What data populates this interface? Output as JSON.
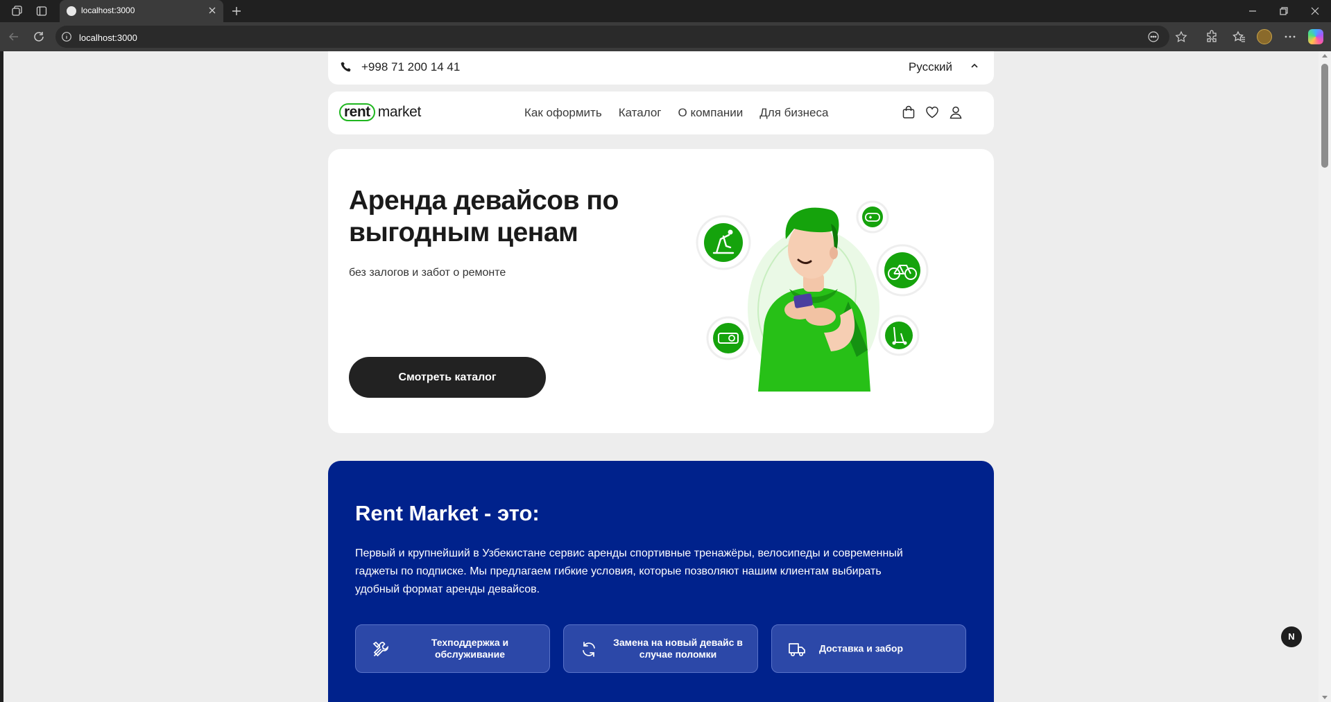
{
  "browser": {
    "tab_title": "localhost:3000",
    "url": "localhost:3000"
  },
  "site": {
    "phone": "+998 71 200 14 41",
    "language": "Русский",
    "logo": {
      "pill": "rent",
      "rest": "market"
    },
    "nav": [
      "Как оформить",
      "Каталог",
      "О компании",
      "Для бизнеса"
    ],
    "hero": {
      "title": "Аренда девайсов по выгодным ценам",
      "subtitle": "без залогов и забот о ремонте",
      "cta": "Смотреть каталог"
    },
    "about": {
      "title": "Rent Market - это:",
      "text": "Первый и крупнейший в Узбекистане сервис аренды спортивные тренажёры, велосипеды и современный гаджеты по подписке. Мы предлагаем гибкие условия, которые позволяют нашим клиентам выбирать удобный формат аренды девайсов.",
      "features": [
        {
          "label": "Техподдержка и обслуживание",
          "icon": "tools-icon"
        },
        {
          "label": "Замена на новый девайс в случае поломки",
          "icon": "refresh-icon"
        },
        {
          "label": "Доставка и забор",
          "icon": "truck-icon"
        }
      ]
    },
    "fab_label": "N"
  },
  "colors": {
    "brand_green": "#1fb61f",
    "about_blue": "#00228c",
    "cta_dark": "#222222"
  }
}
